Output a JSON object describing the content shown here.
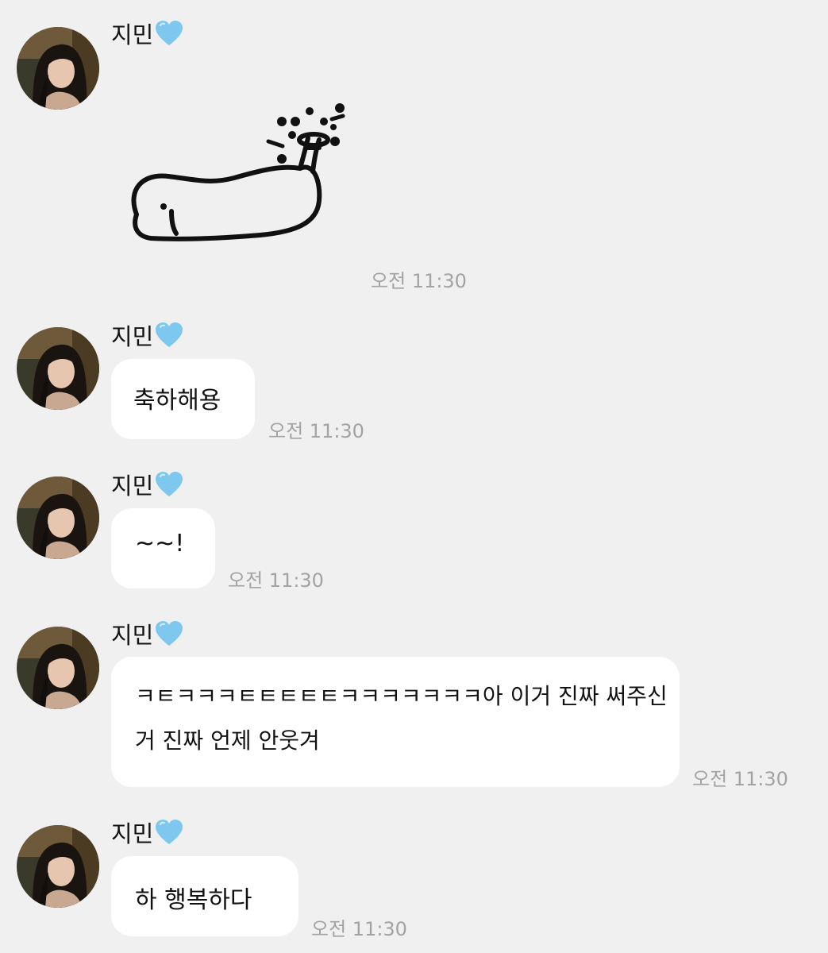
{
  "chat": {
    "messages": [
      {
        "sender": "지민",
        "type": "sticker",
        "sticker": "peacock-doodle-sticker",
        "time": "오전 11:30"
      },
      {
        "sender": "지민",
        "type": "text",
        "text": "축하해용",
        "time": "오전 11:30"
      },
      {
        "sender": "지민",
        "type": "text",
        "text": "~~!",
        "time": "오전 11:30"
      },
      {
        "sender": "지민",
        "type": "text",
        "lines": [
          "ㅋㅌㅋㅋㅋㅌㅌㅌㅌㅌㅋㅋㅋㅋㅋㅋㅋ아 이거 진짜 써주신",
          "거 진짜 언제 안웃겨"
        ],
        "time": "오전 11:30"
      },
      {
        "sender": "지민",
        "type": "text",
        "text": "하 행복하다",
        "time": "오전 11:30"
      }
    ]
  },
  "icons": {
    "sender_badge": "light-blue-heart-icon",
    "avatar": "profile-photo-avatar"
  },
  "colors": {
    "background": "#f0f0f0",
    "bubble": "#ffffff",
    "heart": "#7ec8f0",
    "time": "#a3a3a3"
  }
}
